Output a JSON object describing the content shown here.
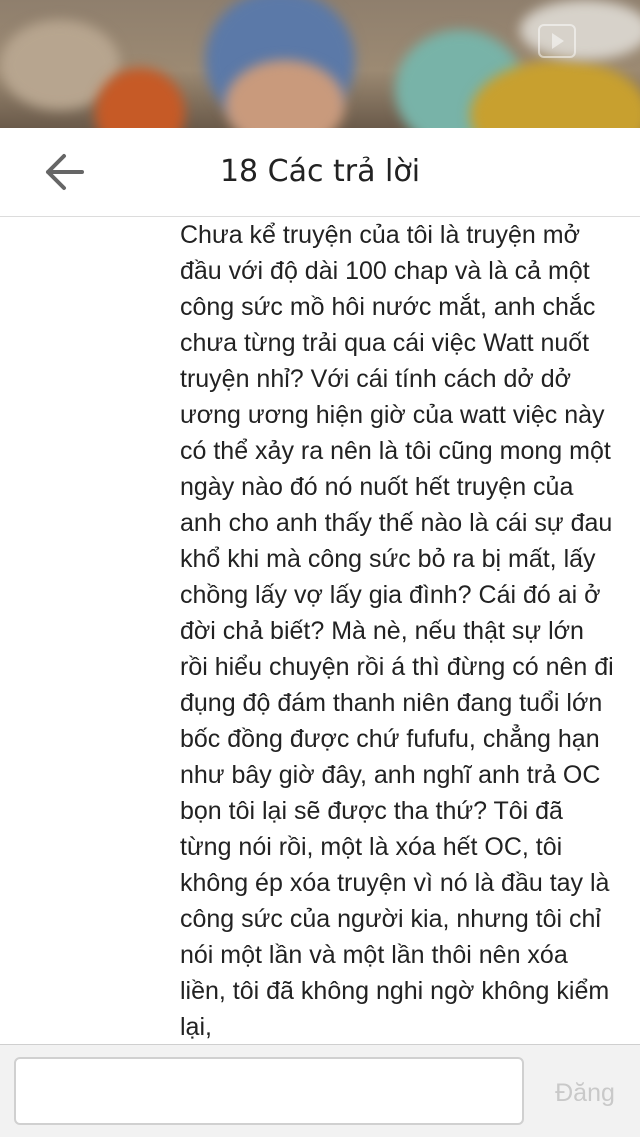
{
  "header": {
    "title": "18 Các trả lời",
    "back_icon": "arrow-left-icon"
  },
  "reply": {
    "text": "Chưa kể truyện của tôi là truyện mở đầu với độ dài 100 chap và là cả một công sức mồ hôi nước mắt, anh chắc chưa từng trải qua cái việc Watt nuốt truyện nhỉ? Với cái tính cách dở dở ương ương hiện giờ của watt việc này có thể xảy ra nên là tôi cũng mong một ngày nào đó nó nuốt hết truyện của anh cho anh thấy thế nào là cái sự đau khổ khi mà công sức bỏ ra bị mất, lấy chồng lấy vợ lấy gia đình? Cái đó ai ở đời chả biết? Mà nè, nếu thật sự lớn rồi hiểu chuyện rồi á thì đừng có nên đi đụng độ đám thanh niên đang tuổi lớn bốc đồng được chứ fufufu, chẳng hạn như bây giờ đây, anh nghĩ anh trả OC bọn tôi lại sẽ được tha thứ? Tôi đã từng nói rồi, một là xóa hết OC, tôi không ép xóa truyện vì nó là đầu tay là công sức của người kia, nhưng tôi chỉ nói một lần và một lần thôi nên xóa liền, tôi đã không nghi ngờ không kiểm lại,"
  },
  "composer": {
    "input_value": "",
    "post_label": "Đăng"
  },
  "colors": {
    "text": "#222222",
    "post_disabled": "#c9c9c9",
    "divider": "#dcdcdc"
  }
}
